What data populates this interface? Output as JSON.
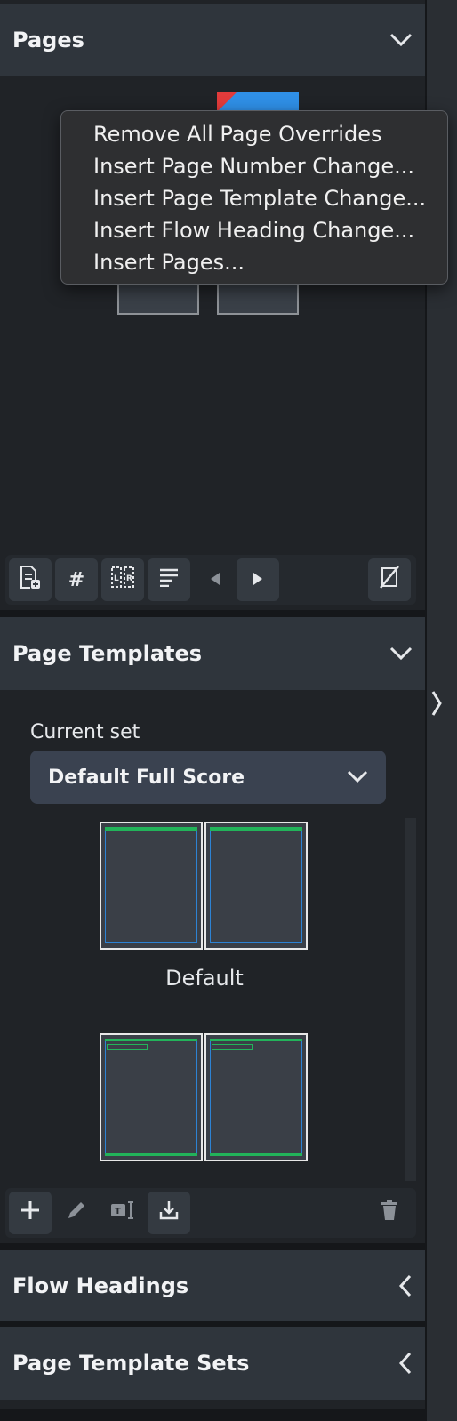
{
  "pages_panel": {
    "title": "Pages",
    "context_menu": {
      "items": [
        "Remove All Page Overrides",
        "Insert Page Number Change...",
        "Insert Page Template Change...",
        "Insert Flow Heading Change...",
        "Insert Pages..."
      ]
    },
    "toolbar": {
      "hash_label": "#"
    }
  },
  "page_templates_panel": {
    "title": "Page Templates",
    "current_set_label": "Current set",
    "current_set_value": "Default Full Score",
    "templates": [
      {
        "label": "Default"
      },
      {
        "label": ""
      }
    ]
  },
  "flow_headings_panel": {
    "title": "Flow Headings"
  },
  "page_template_sets_panel": {
    "title": "Page Template Sets"
  },
  "colors": {
    "header_bg": "#2f353c",
    "panel_bg": "#202327",
    "accent_blue": "#2f8fe6",
    "accent_red": "#e23b3b",
    "template_green": "#22b35a"
  }
}
